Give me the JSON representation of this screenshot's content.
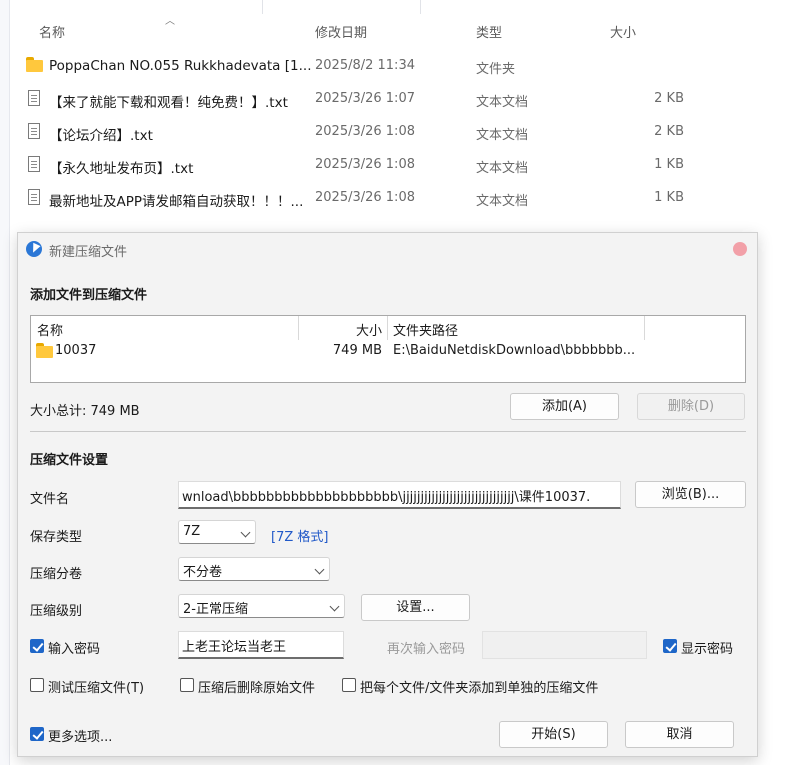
{
  "explorer": {
    "columns": {
      "name": "名称",
      "date": "修改日期",
      "type": "类型",
      "size": "大小"
    },
    "files": [
      {
        "name": "PoppaChan NO.055 Rukkhadevata [1...",
        "date": "2025/8/2 11:34",
        "type": "文件夹",
        "size": "",
        "icon": "folder-icon"
      },
      {
        "name": "【来了就能下载和观看！纯免费！】.txt",
        "date": "2025/3/26 1:07",
        "type": "文本文档",
        "size": "2 KB",
        "icon": "text-file-icon"
      },
      {
        "name": "【论坛介绍】.txt",
        "date": "2025/3/26 1:08",
        "type": "文本文档",
        "size": "2 KB",
        "icon": "text-file-icon"
      },
      {
        "name": "【永久地址发布页】.txt",
        "date": "2025/3/26 1:08",
        "type": "文本文档",
        "size": "1 KB",
        "icon": "text-file-icon"
      },
      {
        "name": "最新地址及APP请发邮箱自动获取！！！...",
        "date": "2025/3/26 1:08",
        "type": "文本文档",
        "size": "1 KB",
        "icon": "text-file-icon"
      }
    ]
  },
  "dialog": {
    "title": "新建压缩文件",
    "add_section": {
      "title": "添加文件到压缩文件",
      "columns": {
        "name": "名称",
        "size": "大小",
        "path": "文件夹路径"
      },
      "items": [
        {
          "name": "10037",
          "size": "749 MB",
          "path": "E:\\BaiduNetdiskDownload\\bbbbbbb..."
        }
      ],
      "total_label": "大小总计: 749 MB",
      "add_button": "添加(A)",
      "delete_button": "删除(D)"
    },
    "settings": {
      "title": "压缩文件设置",
      "filename_label": "文件名",
      "filename_value": "wnload\\bbbbbbbbbbbbbbbbbbbb\\jjjjjjjjjjjjjjjjjjjjjjjjjjjjjjj\\课件10037.",
      "browse_button": "浏览(B)...",
      "save_type_label": "保存类型",
      "save_type_value": "7Z",
      "save_type_link": "[7Z 格式]",
      "split_label": "压缩分卷",
      "split_value": "不分卷",
      "level_label": "压缩级别",
      "level_value": "2-正常压缩",
      "settings_button": "设置...",
      "password_label": "输入密码",
      "password_value": "上老王论坛当老王",
      "reenter_label": "再次输入密码",
      "show_password_label": "显示密码",
      "test_label": "测试压缩文件(T)",
      "delete_after_label": "压缩后删除原始文件",
      "separate_label": "把每个文件/文件夹添加到单独的压缩文件",
      "more_options_label": "更多选项...",
      "start_button": "开始(S)",
      "cancel_button": "取消"
    }
  }
}
